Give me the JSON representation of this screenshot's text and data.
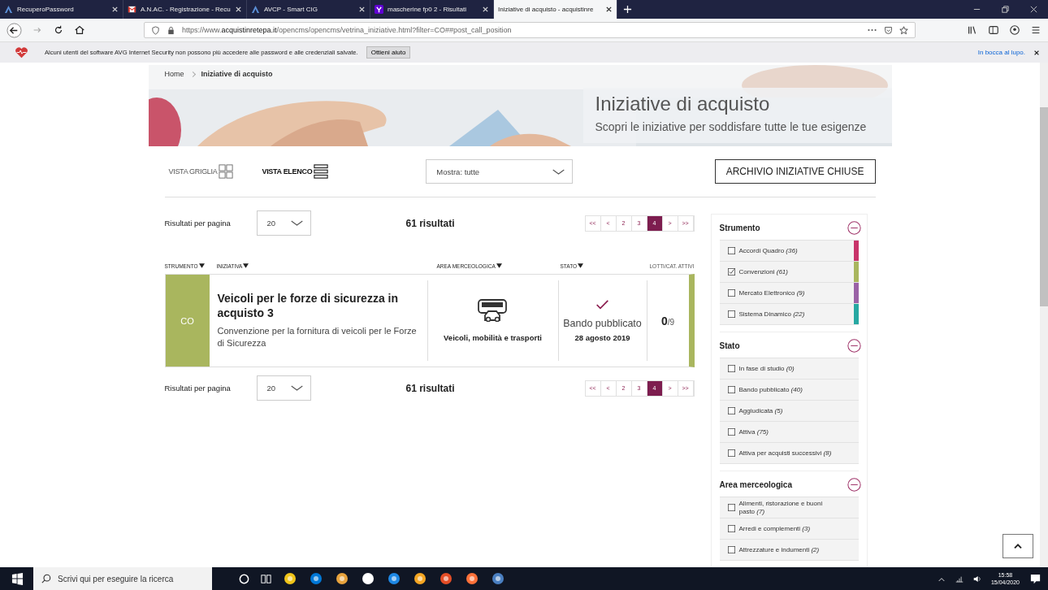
{
  "browser": {
    "tabs": [
      {
        "title": "RecuperoPassword",
        "selected": false
      },
      {
        "title": "A.N.AC. - Registrazione - Recu",
        "selected": false
      },
      {
        "title": "AVCP - Smart CIG",
        "selected": false
      },
      {
        "title": "mascherine fp0 2 - Risultati",
        "selected": false
      },
      {
        "title": "Iniziative di acquisto - acquistinre",
        "selected": true
      }
    ],
    "url": "https://www.**acquistinretepa.it**/opencms/opencms/vetrina_iniziative.html?filter=CO##post_call_position"
  },
  "notification": {
    "text": "Alcuni utenti del software AVG Internet Security non possono più accedere alle password e alle credenziali salvate.",
    "button": "Ottieni aiuto",
    "link": "In bocca al lupo."
  },
  "breadcrumb": [
    "Home",
    "Iniziative di acquisto"
  ],
  "hero": {
    "title": "Iniziative di acquisto",
    "subtitle": "Scopri le iniziative per soddisfare tutte le tue esigenze"
  },
  "views": [
    {
      "label": "VISTA GRIGLIA",
      "kind": "grid",
      "selected": false
    },
    {
      "label": "VISTA ELENCO",
      "kind": "list",
      "selected": true
    }
  ],
  "show_select": "Mostra: tutte",
  "archive_button": "ARCHIVIO INIZIATIVE CHIUSE",
  "result_bars": [
    {
      "per_page_label": "Risultati per pagina",
      "per_page": "20",
      "count": "61 risultati",
      "pages": [
        {
          "label": "<<",
          "selected": false
        },
        {
          "label": "<",
          "selected": false
        },
        {
          "label": "2",
          "selected": false
        },
        {
          "label": "3",
          "selected": false
        },
        {
          "label": "4",
          "selected": true
        },
        {
          "label": ">",
          "selected": false
        },
        {
          "label": ">>",
          "selected": false
        }
      ]
    },
    {
      "per_page_label": "Risultati per pagina",
      "per_page": "20",
      "count": "61 risultati",
      "pages": [
        {
          "label": "<<",
          "selected": false
        },
        {
          "label": "<",
          "selected": false
        },
        {
          "label": "2",
          "selected": false
        },
        {
          "label": "3",
          "selected": false
        },
        {
          "label": "4",
          "selected": true
        },
        {
          "label": ">",
          "selected": false
        },
        {
          "label": ">>",
          "selected": false
        }
      ]
    }
  ],
  "columns": [
    {
      "label": "STRUMENTO",
      "sortable": true
    },
    {
      "label": "INIZIATIVA",
      "sortable": true
    },
    {
      "label": "AREA MERCEOLOGICA",
      "sortable": true
    },
    {
      "label": "STATO",
      "sortable": true
    },
    {
      "label": "LOTTI/CAT. ATTIVI",
      "sortable": false
    }
  ],
  "rows": [
    {
      "code": "CO",
      "color": "#a9b65e",
      "title": "Veicoli per le forze di sicurezza in acquisto 3",
      "description": "Convenzione per la fornitura di veicoli per le Forze di Sicurezza",
      "area": "Veicoli, mobilità e trasporti",
      "status": "Bando pubblicato",
      "date": "28 agosto 2019",
      "lots": "**0**/9"
    }
  ],
  "filters": [
    {
      "title": "Strumento",
      "expanded": true,
      "items": [
        {
          "label": "Accordi Quadro *(36)*",
          "checked": false,
          "color": "#c8346a"
        },
        {
          "label": "Convenzioni *(61)*",
          "checked": true,
          "color": "#a9b65e"
        },
        {
          "label": "Mercato Elettronico *(9)*",
          "checked": false,
          "color": "#9a62a6"
        },
        {
          "label": "Sistema Dinamico *(22)*",
          "checked": false,
          "color": "#27a8a2"
        }
      ]
    },
    {
      "title": "Stato",
      "expanded": true,
      "items": [
        {
          "label": "In fase di studio *(0)*",
          "checked": false
        },
        {
          "label": "Bando pubblicato *(40)*",
          "checked": false
        },
        {
          "label": "Aggiudicata *(5)*",
          "checked": false
        },
        {
          "label": "Attiva *(75)*",
          "checked": false
        },
        {
          "label": "Attiva per acquisti successivi *(8)*",
          "checked": false
        }
      ]
    },
    {
      "title": "Area merceologica",
      "expanded": true,
      "items": [
        {
          "label": "Alimenti, ristorazione e buoni pasto *(7)*",
          "checked": false
        },
        {
          "label": "Arredi e complementi *(3)*",
          "checked": false
        },
        {
          "label": "Attrezzature e indumenti *(2)*",
          "checked": false
        }
      ]
    }
  ],
  "taskbar": {
    "search_placeholder": "Scrivi qui per eseguire la ricerca",
    "time": "15:58",
    "date": "15/04/2020"
  }
}
